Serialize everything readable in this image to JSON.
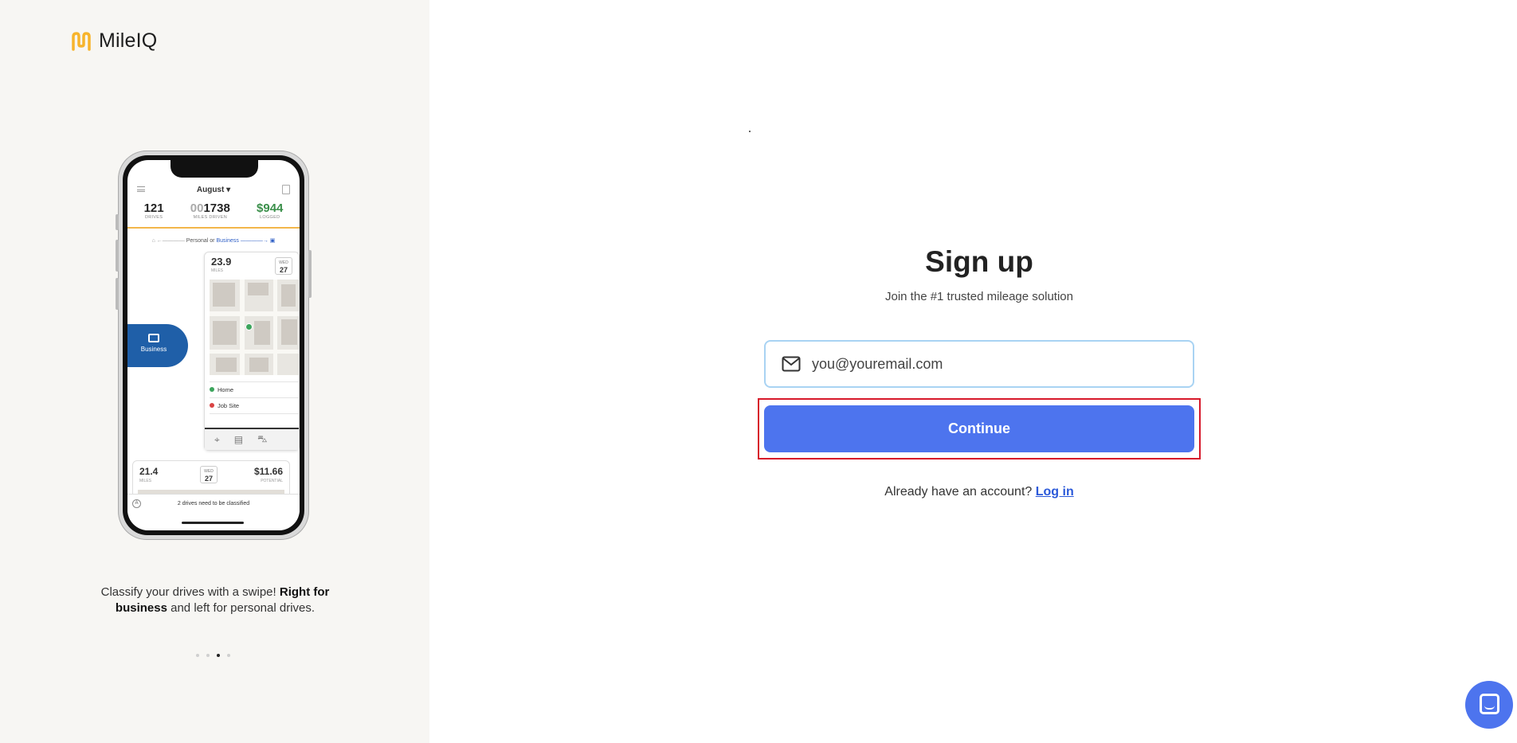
{
  "brand": {
    "name": "MileIQ",
    "logo_color": "#f7b42c"
  },
  "promo": {
    "phone": {
      "month": "August ▾",
      "stats": [
        {
          "value": "121",
          "label": "DRIVES"
        },
        {
          "value_dim": "00",
          "value": "1738",
          "label": "MILES DRIVEN"
        },
        {
          "value": "$944",
          "label": "LOGGED"
        }
      ],
      "swipe_left": "Personal or",
      "swipe_right": "Business",
      "drive1": {
        "miles": "23.9",
        "miles_label": "MILES",
        "day": "WED",
        "date": "27",
        "from": "Home",
        "to": "Job Site"
      },
      "business_label": "Business",
      "drive2": {
        "miles": "21.4",
        "miles_label": "MILES",
        "day": "WED",
        "date": "27",
        "potential": "$11.66",
        "potential_label": "POTENTIAL"
      },
      "bottom_text": "2 drives need to be classified"
    },
    "caption_prefix": "Classify your drives with a swipe! ",
    "caption_bold": "Right for business",
    "caption_suffix": " and left for personal drives.",
    "carousel_active_index": 2,
    "carousel_count": 4
  },
  "signup": {
    "title": "Sign up",
    "subtitle": "Join the #1 trusted mileage solution",
    "email_placeholder": "you@youremail.com",
    "email_value": "",
    "continue_label": "Continue",
    "already_text": "Already have an account?",
    "login_label": "Log in",
    "accent": "#4d74ee"
  },
  "chat_widget": {
    "icon": "chat-icon"
  }
}
